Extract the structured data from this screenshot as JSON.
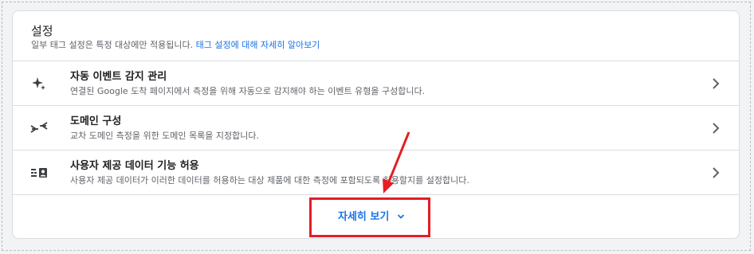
{
  "settings": {
    "title": "설정",
    "subtitle_text": "일부 태그 설정은 특정 대상에만 적용됩니다.",
    "subtitle_link": "태그 설정에 대해 자세히 알아보기"
  },
  "rows": [
    {
      "icon": "sparkle-icon",
      "title": "자동 이벤트 감지 관리",
      "description": "연결된 Google 도착 페이지에서 측정을 위해 자동으로 감지해야 하는 이벤트 유형을 구성합니다."
    },
    {
      "icon": "merge-arrows-icon",
      "title": "도메인 구성",
      "description": "교차 도메인 측정을 위한 도메인 목록을 지정합니다."
    },
    {
      "icon": "user-data-icon",
      "title": "사용자 제공 데이터 기능 허용",
      "description": "사용자 제공 데이터가 이러한 데이터를 허용하는 대상 제품에 대한 측정에 포함되도록 허용할지를 설정합니다."
    }
  ],
  "footer": {
    "more_label": "자세히 보기",
    "more_icon": "chevron-down-icon"
  },
  "annotation": {
    "color": "#e31e24"
  }
}
